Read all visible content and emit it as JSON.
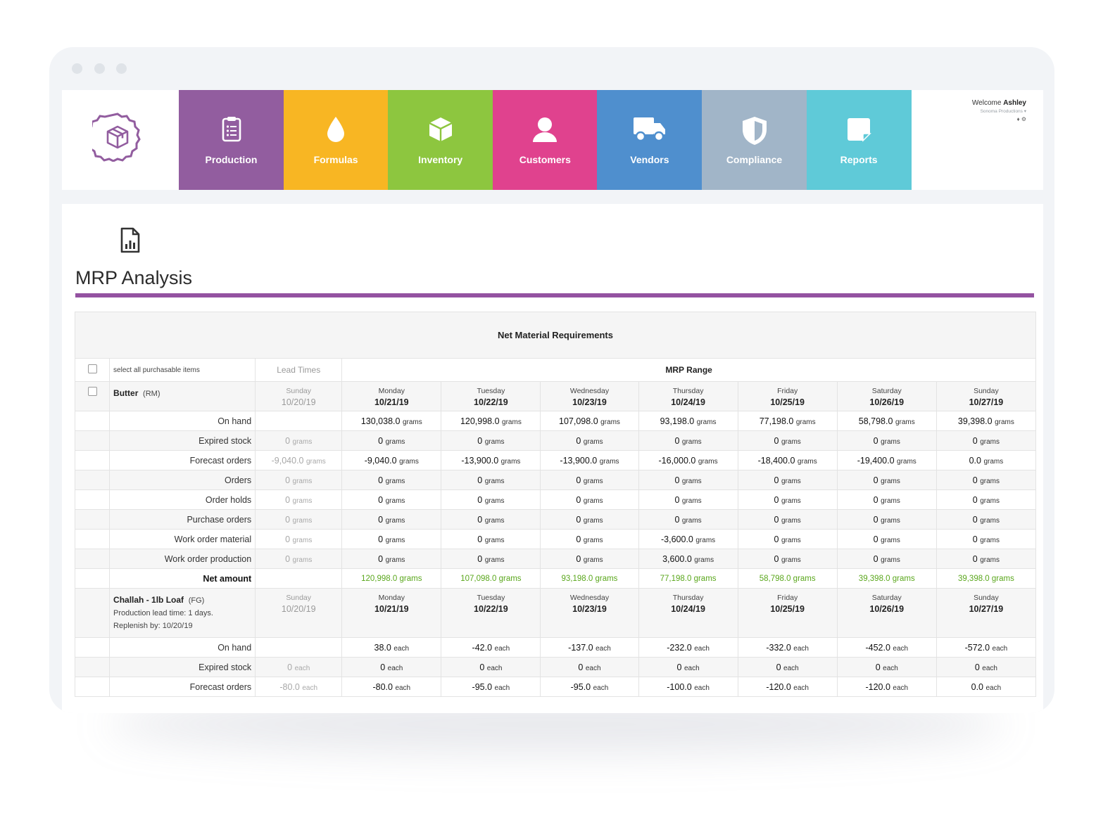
{
  "nav": {
    "tiles": [
      {
        "label": "Production",
        "icon": "clipboard-icon",
        "color": "#925d9f"
      },
      {
        "label": "Formulas",
        "icon": "droplet-icon",
        "color": "#f8b623"
      },
      {
        "label": "Inventory",
        "icon": "box-icon",
        "color": "#8dc63f"
      },
      {
        "label": "Customers",
        "icon": "user-icon",
        "color": "#e0428e"
      },
      {
        "label": "Vendors",
        "icon": "truck-icon",
        "color": "#4f8fce"
      },
      {
        "label": "Compliance",
        "icon": "shield-icon",
        "color": "#a1b5c8"
      },
      {
        "label": "Reports",
        "icon": "note-icon",
        "color": "#5fcad8"
      }
    ],
    "welcome_prefix": "Welcome",
    "user_name": "Ashley",
    "company": "Sonoma Productions ▾",
    "user_icons": "♦  ⚙"
  },
  "page": {
    "title": "MRP Analysis",
    "accent": "#9452a1"
  },
  "table": {
    "heading": "Net Material Requirements",
    "select_all": "select all purchasable items",
    "lead_times": "Lead Times",
    "mrp_range": "MRP Range",
    "items": [
      {
        "name": "Butter",
        "type": "(RM)",
        "notes": [],
        "lead_day": {
          "day": "Sunday",
          "date": "10/20/19"
        },
        "days": [
          {
            "day": "Monday",
            "date": "10/21/19"
          },
          {
            "day": "Tuesday",
            "date": "10/22/19"
          },
          {
            "day": "Wednesday",
            "date": "10/23/19"
          },
          {
            "day": "Thursday",
            "date": "10/24/19"
          },
          {
            "day": "Friday",
            "date": "10/25/19"
          },
          {
            "day": "Saturday",
            "date": "10/26/19"
          },
          {
            "day": "Sunday",
            "date": "10/27/19"
          }
        ],
        "unit": "grams",
        "rows": [
          {
            "label": "On hand",
            "lead": "",
            "values": [
              "130,038.0",
              "120,998.0",
              "107,098.0",
              "93,198.0",
              "77,198.0",
              "58,798.0",
              "39,398.0"
            ]
          },
          {
            "label": "Expired stock",
            "lead": "0",
            "values": [
              "0",
              "0",
              "0",
              "0",
              "0",
              "0",
              "0"
            ]
          },
          {
            "label": "Forecast orders",
            "lead": "-9,040.0",
            "values": [
              "-9,040.0",
              "-13,900.0",
              "-13,900.0",
              "-16,000.0",
              "-18,400.0",
              "-19,400.0",
              "0.0"
            ]
          },
          {
            "label": "Orders",
            "lead": "0",
            "values": [
              "0",
              "0",
              "0",
              "0",
              "0",
              "0",
              "0"
            ]
          },
          {
            "label": "Order holds",
            "lead": "0",
            "values": [
              "0",
              "0",
              "0",
              "0",
              "0",
              "0",
              "0"
            ]
          },
          {
            "label": "Purchase orders",
            "lead": "0",
            "values": [
              "0",
              "0",
              "0",
              "0",
              "0",
              "0",
              "0"
            ]
          },
          {
            "label": "Work order material",
            "lead": "0",
            "values": [
              "0",
              "0",
              "0",
              "-3,600.0",
              "0",
              "0",
              "0"
            ]
          },
          {
            "label": "Work order production",
            "lead": "0",
            "values": [
              "0",
              "0",
              "0",
              "3,600.0",
              "0",
              "0",
              "0"
            ]
          }
        ],
        "net": {
          "label": "Net amount",
          "values": [
            "120,998.0",
            "107,098.0",
            "93,198.0",
            "77,198.0",
            "58,798.0",
            "39,398.0",
            "39,398.0"
          ]
        }
      },
      {
        "name": "Challah - 1lb Loaf",
        "type": "(FG)",
        "notes": [
          "Production lead time: 1 days.",
          "Replenish by: 10/20/19"
        ],
        "lead_day": {
          "day": "Sunday",
          "date": "10/20/19"
        },
        "days": [
          {
            "day": "Monday",
            "date": "10/21/19"
          },
          {
            "day": "Tuesday",
            "date": "10/22/19"
          },
          {
            "day": "Wednesday",
            "date": "10/23/19"
          },
          {
            "day": "Thursday",
            "date": "10/24/19"
          },
          {
            "day": "Friday",
            "date": "10/25/19"
          },
          {
            "day": "Saturday",
            "date": "10/26/19"
          },
          {
            "day": "Sunday",
            "date": "10/27/19"
          }
        ],
        "unit": "each",
        "rows": [
          {
            "label": "On hand",
            "lead": "",
            "values": [
              "38.0",
              "-42.0",
              "-137.0",
              "-232.0",
              "-332.0",
              "-452.0",
              "-572.0"
            ]
          },
          {
            "label": "Expired stock",
            "lead": "0",
            "values": [
              "0",
              "0",
              "0",
              "0",
              "0",
              "0",
              "0"
            ]
          },
          {
            "label": "Forecast orders",
            "lead": "-80.0",
            "values": [
              "-80.0",
              "-95.0",
              "-95.0",
              "-100.0",
              "-120.0",
              "-120.0",
              "0.0"
            ]
          }
        ]
      }
    ]
  }
}
